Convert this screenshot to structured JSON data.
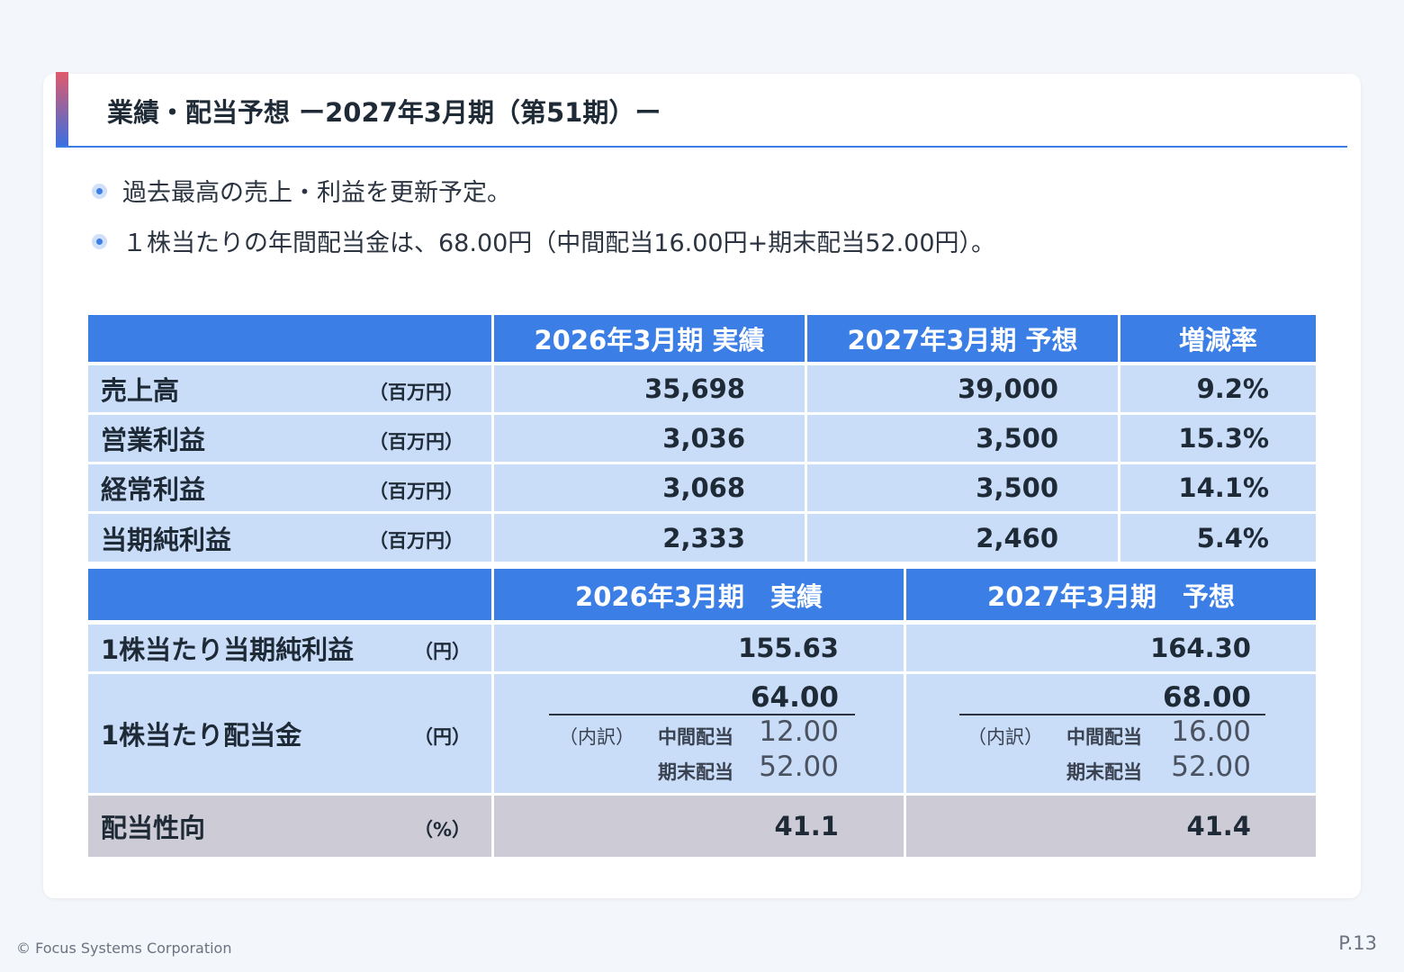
{
  "title": "業績・配当予想 ー2027年3月期（第51期）ー",
  "bullets": [
    "過去最高の売上・利益を更新予定。",
    "１株当たりの年間配当金は、68.00円（中間配当16.00円+期末配当52.00円）。"
  ],
  "table1": {
    "headers": [
      "",
      "2026年3月期 実績",
      "2027年3月期 予想",
      "増減率"
    ],
    "rows": [
      {
        "label": "売上高",
        "unit": "（百万円）",
        "actual": "35,698",
        "forecast": "39,000",
        "change": "9.2%"
      },
      {
        "label": "営業利益",
        "unit": "（百万円）",
        "actual": "3,036",
        "forecast": "3,500",
        "change": "15.3%"
      },
      {
        "label": "経常利益",
        "unit": "（百万円）",
        "actual": "3,068",
        "forecast": "3,500",
        "change": "14.1%"
      },
      {
        "label": "当期純利益",
        "unit": "（百万円）",
        "actual": "2,333",
        "forecast": "2,460",
        "change": "5.4%"
      }
    ]
  },
  "table2": {
    "headers": [
      "",
      "2026年3月期　実績",
      "2027年3月期　予想"
    ],
    "eps": {
      "label": "1株当たり当期純利益",
      "unit": "（円）",
      "actual": "155.63",
      "forecast": "164.30"
    },
    "dividend": {
      "label": "1株当たり配当金",
      "unit": "（円）",
      "breakdown_label": "（内訳）",
      "interim_label": "中間配当",
      "final_label": "期末配当",
      "actual": {
        "total": "64.00",
        "interim": "12.00",
        "final": "52.00"
      },
      "forecast": {
        "total": "68.00",
        "interim": "16.00",
        "final": "52.00"
      }
    },
    "payout": {
      "label": "配当性向",
      "unit": "（%）",
      "actual": "41.1",
      "forecast": "41.4"
    }
  },
  "footer": {
    "copyright": "© Focus Systems Corporation",
    "page": "P.13"
  },
  "colors": {
    "header_blue": "#3b7fe6",
    "row_blue": "#c9dcf8",
    "row_gray": "#cdccd6"
  }
}
